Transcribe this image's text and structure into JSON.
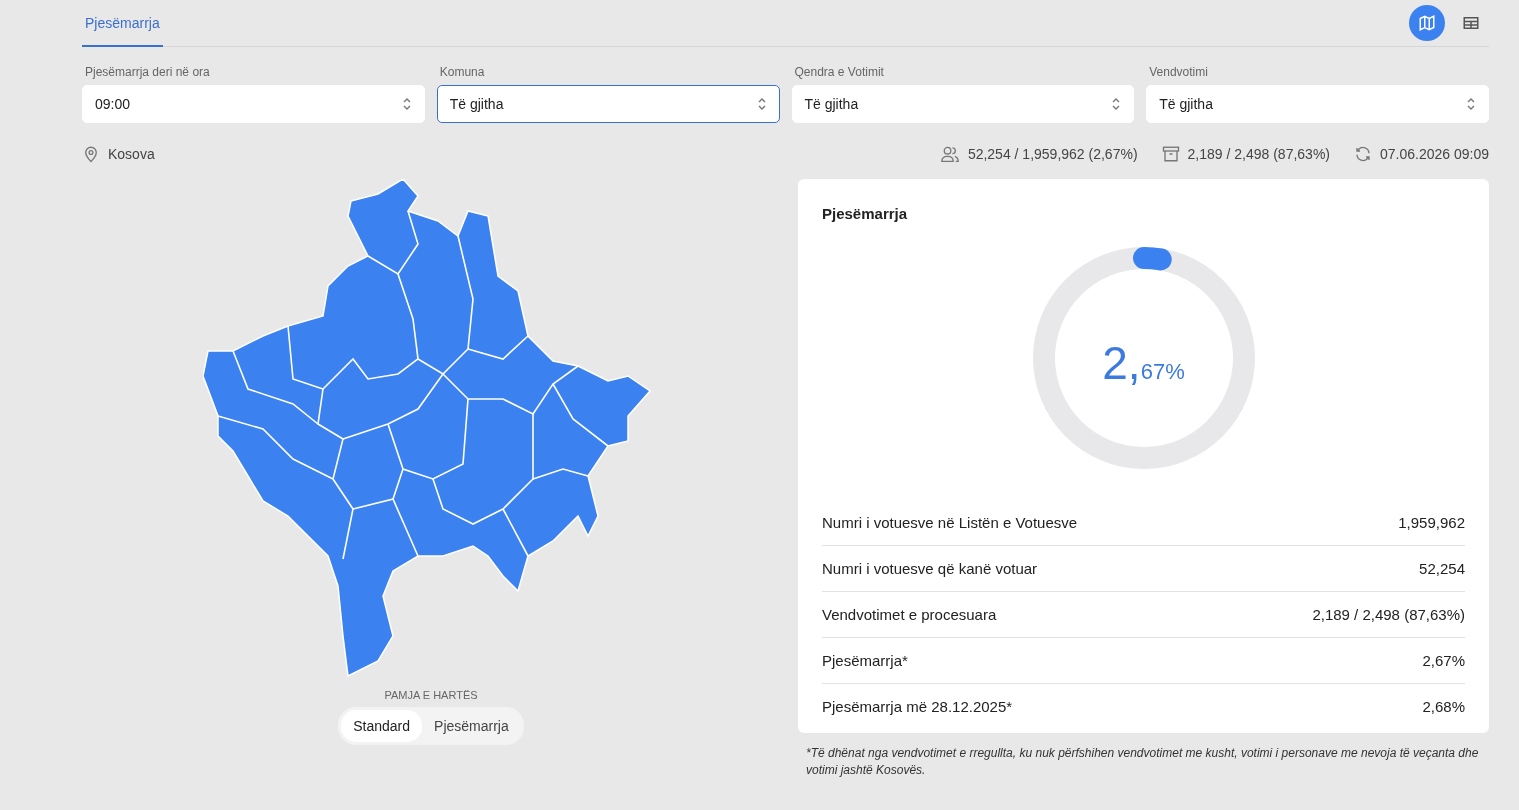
{
  "tabs": [
    {
      "label": "Pjesëmarrja",
      "selected": true
    }
  ],
  "view_toggle": [
    {
      "kind": "map",
      "selected": true
    },
    {
      "kind": "table",
      "selected": false
    }
  ],
  "filters": [
    {
      "label": "Pjesëmarrja deri në ora",
      "value": "09:00",
      "focused": false
    },
    {
      "label": "Komuna",
      "value": "Të gjitha",
      "focused": true
    },
    {
      "label": "Qendra e Votimit",
      "value": "Të gjitha",
      "focused": false
    },
    {
      "label": "Vendvotimi",
      "value": "Të gjitha",
      "focused": false
    }
  ],
  "location": "Kosova",
  "stats": [
    {
      "kind": "voters",
      "text": "52,254 / 1,959,962 (2,67%)"
    },
    {
      "kind": "stations",
      "text": "2,189 / 2,498 (87,63%)"
    },
    {
      "kind": "updated",
      "text": "07.06.2026 09:09"
    }
  ],
  "map_view": {
    "label": "PAMJA E HARTËS",
    "options": [
      {
        "label": "Standard",
        "selected": true
      },
      {
        "label": "Pjesëmarrja",
        "selected": false
      }
    ]
  },
  "card": {
    "title": "Pjesëmarrja",
    "gauge": {
      "whole": "2,",
      "fraction": "67%"
    },
    "rows": [
      {
        "label": "Numri i votuesve në Listën e Votuesve",
        "value": "1,959,962"
      },
      {
        "label": "Numri i votuesve që kanë votuar",
        "value": "52,254"
      },
      {
        "label": "Vendvotimet e procesuara",
        "value": "2,189 / 2,498 (87,63%)"
      },
      {
        "label": "Pjesëmarrja*",
        "value": "2,67%"
      },
      {
        "label": "Pjesëmarrja më 28.12.2025*",
        "value": "2,68%"
      }
    ]
  },
  "footnote": "*Të dhënat nga vendvotimet e rregullta, ku nuk përfshihen vendvotimet me kusht, votimi i personave me nevoja të veçanta dhe votimi jashtë Kosovës."
}
